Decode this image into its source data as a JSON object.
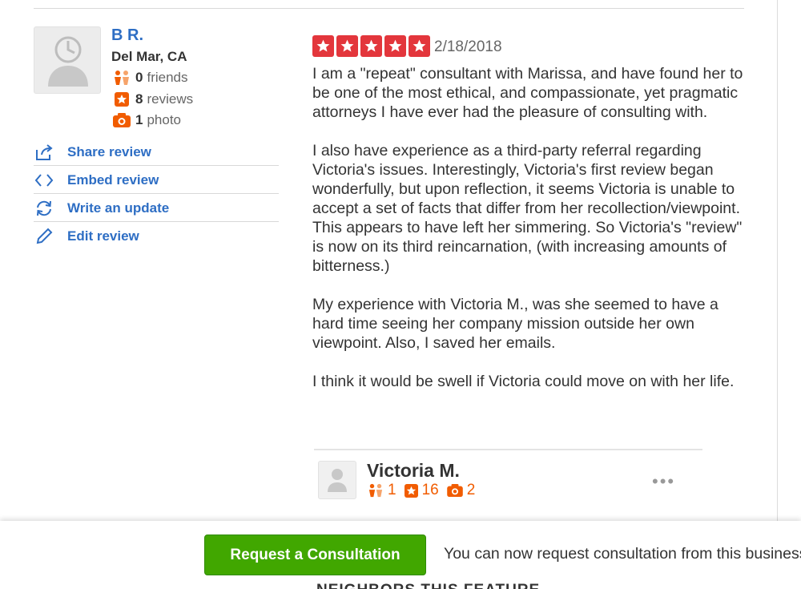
{
  "reviewer": {
    "name": "B R.",
    "location": "Del Mar, CA",
    "friends_count": "0",
    "friends_label": "friends",
    "reviews_count": "8",
    "reviews_label": "reviews",
    "photos_count": "1",
    "photos_label": "photo"
  },
  "actions": [
    {
      "label": "Share review",
      "icon": "share-icon"
    },
    {
      "label": "Embed review",
      "icon": "embed-icon"
    },
    {
      "label": "Write an update",
      "icon": "refresh-icon"
    },
    {
      "label": "Edit review",
      "icon": "pencil-icon"
    }
  ],
  "review": {
    "rating": 5,
    "date": "2/18/2018",
    "paragraphs": [
      "I am a \"repeat\" consultant with Marissa, and have found her to be one of the most ethical, and compassionate, yet pragmatic attorneys I have ever had the pleasure of consulting with.",
      "I also have experience as a third-party referral regarding Victoria's issues.  Interestingly, Victoria's first review began wonderfully, but upon reflection, it seems Victoria is unable to accept a set of facts that differ from her recollection/viewpoint.  This appears to have left her simmering. So Victoria's \"review\" is now on its third reincarnation, (with increasing amounts of bitterness.)",
      "My experience with Victoria M., was she seemed to have a hard time seeing her company mission outside her own viewpoint. Also, I saved her emails.",
      "I think it would be swell if Victoria could move on with her life."
    ]
  },
  "reply": {
    "name": "Victoria M.",
    "friends_count": "1",
    "reviews_count": "16",
    "photos_count": "2",
    "more_label": "•••"
  },
  "bottom_bar": {
    "button_label": "Request a Consultation",
    "message": "You can now request consultation from this business",
    "partial_text_below": "NEIGHBORS THIS FEATURE"
  },
  "colors": {
    "link_blue": "#2e6ec4",
    "star_red": "#e3363c",
    "stat_orange": "#f15c00",
    "button_green": "#41a700"
  }
}
